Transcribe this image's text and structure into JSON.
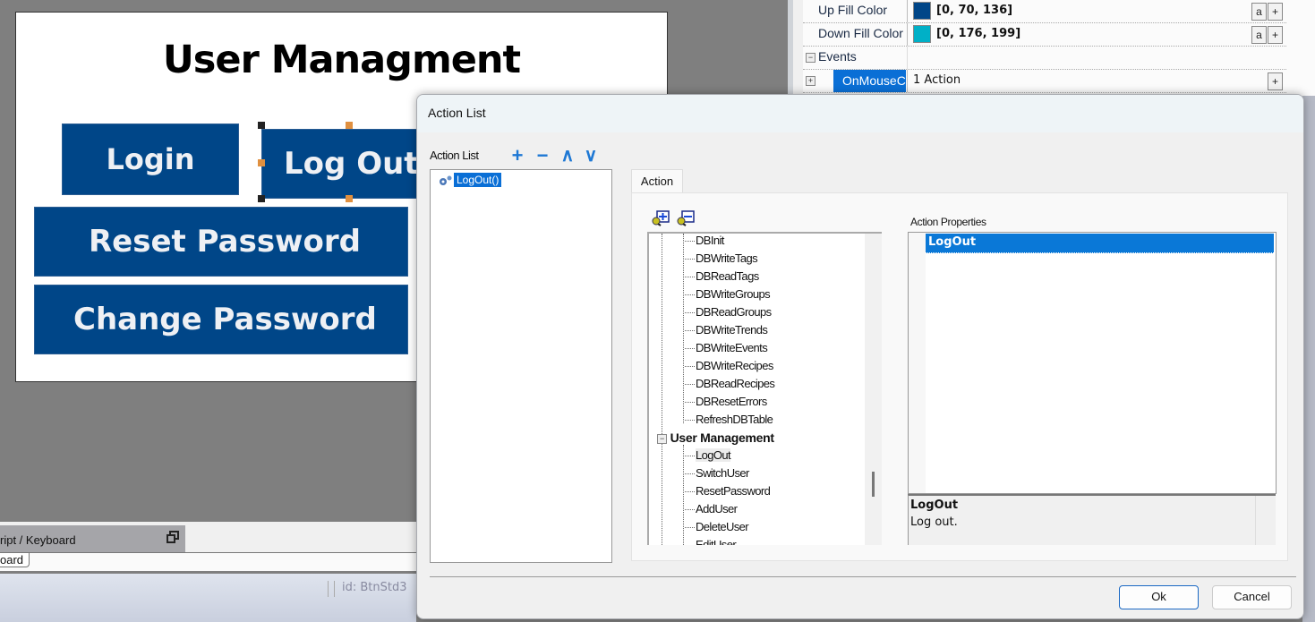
{
  "canvas": {
    "title": "User Managment",
    "buttons": {
      "login": "Login",
      "logout": "Log Out",
      "reset_password": "Reset Password",
      "change_password": "Change Password"
    }
  },
  "properties": {
    "rows": [
      {
        "name": "Up Fill Color",
        "value": "[0, 70, 136]",
        "swatch": "#004688",
        "btn_a": "a",
        "btn_plus": "+"
      },
      {
        "name": "Down Fill Color",
        "value": "[0, 176, 199]",
        "swatch": "#00b0c7",
        "btn_a": "a",
        "btn_plus": "+"
      }
    ],
    "events_label": "Events",
    "event": {
      "name": "OnMouseClick",
      "value": "1 Action",
      "btn_plus": "+"
    },
    "collapse_glyph": "−",
    "expand_glyph": "+"
  },
  "bottom_panel": {
    "tab_label": "ript / Keyboard",
    "subtab_label": "oard",
    "status_id": "id:  BtnStd3"
  },
  "dialog": {
    "title": "Action List",
    "action_list_label": "Action List",
    "toolbar": {
      "add": "+",
      "remove": "−",
      "up": "∧",
      "down": "∨"
    },
    "action_items": [
      "LogOut()"
    ],
    "tab_label": "Action",
    "tree": {
      "db_items": [
        "DBInit",
        "DBWriteTags",
        "DBReadTags",
        "DBWriteGroups",
        "DBReadGroups",
        "DBWriteTrends",
        "DBWriteEvents",
        "DBWriteRecipes",
        "DBReadRecipes",
        "DBResetErrors",
        "RefreshDBTable"
      ],
      "group": "User Management",
      "group_expander": "−",
      "user_items": [
        "LogOut",
        "SwitchUser",
        "ResetPassword",
        "AddUser",
        "DeleteUser",
        "EditUser"
      ],
      "highlighted": "LogOut"
    },
    "properties_label": "Action Properties",
    "selected_property": "LogOut",
    "description_title": "LogOut",
    "description_text": "Log out.",
    "ok_label": "Ok",
    "cancel_label": "Cancel"
  }
}
